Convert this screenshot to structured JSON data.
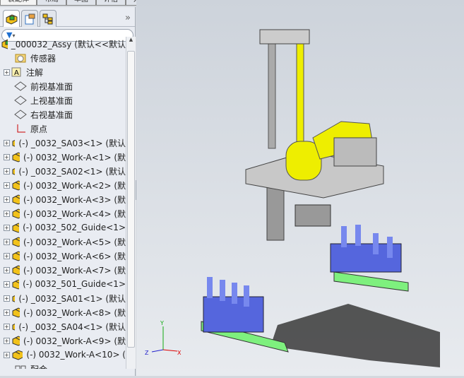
{
  "command_tabs": [
    "装配体",
    "布局",
    "草图",
    "评估",
    "办公室产品"
  ],
  "panel": {
    "more": "»",
    "filter_icon": "funnel-icon"
  },
  "tree": {
    "root": "_000032_Assy  (默认<<默认",
    "fixed": [
      "传感器",
      "注解",
      "前视基准面",
      "上视基准面",
      "右视基准面",
      "原点"
    ],
    "components": [
      {
        "label": "(-) _0032_SA03<1> (默认",
        "sub": true
      },
      {
        "label": "(-) 0032_Work-A<1> (默",
        "sub": false
      },
      {
        "label": "(-) _0032_SA02<1> (默认",
        "sub": true
      },
      {
        "label": "(-) 0032_Work-A<2> (默",
        "sub": false
      },
      {
        "label": "(-) 0032_Work-A<3> (默",
        "sub": false
      },
      {
        "label": "(-) 0032_Work-A<4> (默",
        "sub": false
      },
      {
        "label": "(-) 0032_502_Guide<1>",
        "sub": false
      },
      {
        "label": "(-) 0032_Work-A<5> (默",
        "sub": false
      },
      {
        "label": "(-) 0032_Work-A<6> (默",
        "sub": false
      },
      {
        "label": "(-) 0032_Work-A<7> (默",
        "sub": false
      },
      {
        "label": "(-) 0032_501_Guide<1>",
        "sub": false
      },
      {
        "label": "(-) _0032_SA01<1> (默认",
        "sub": true
      },
      {
        "label": "(-) 0032_Work-A<8> (默",
        "sub": false
      },
      {
        "label": "(-) _0032_SA04<1> (默认",
        "sub": true
      },
      {
        "label": "(-) 0032_Work-A<9> (默",
        "sub": false
      },
      {
        "label": "(-) 0032_Work-A<10> (",
        "sub": false
      }
    ],
    "last": "配合"
  },
  "triad": {
    "x": "X",
    "y": "Y",
    "z": "Z"
  }
}
